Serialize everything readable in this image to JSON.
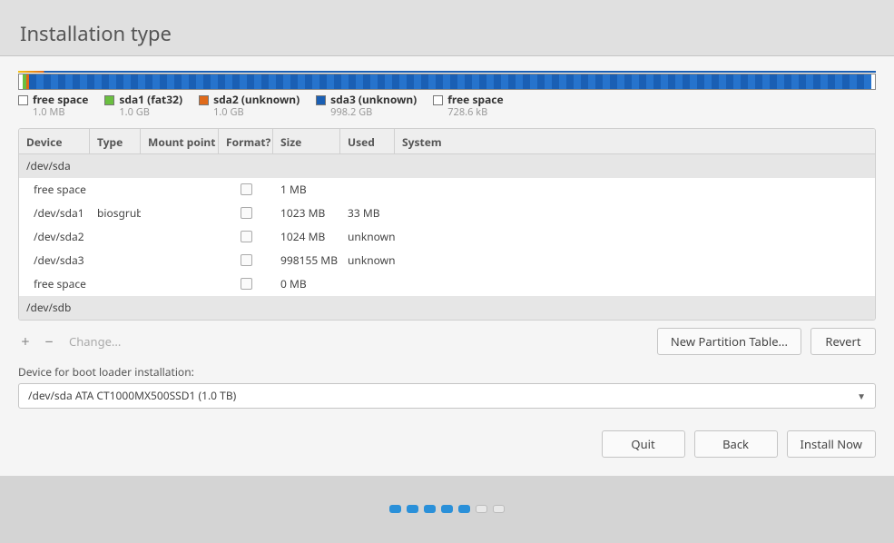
{
  "title": "Installation type",
  "diskbar": [
    {
      "class": "c-free",
      "width": "0.4%"
    },
    {
      "class": "c-green",
      "width": "0.4%"
    },
    {
      "class": "c-orange",
      "width": "0.4%"
    },
    {
      "class": "c-blue",
      "width": "98.4%"
    },
    {
      "class": "c-free",
      "width": "0.4%"
    }
  ],
  "legend": [
    {
      "color": "#ffffff",
      "label": "free space",
      "size": "1.0 MB"
    },
    {
      "color": "#6abf40",
      "label": "sda1 (fat32)",
      "size": "1.0 GB"
    },
    {
      "color": "#e06a1a",
      "label": "sda2 (unknown)",
      "size": "1.0 GB"
    },
    {
      "color": "#1a5fb4",
      "label": "sda3 (unknown)",
      "size": "998.2 GB"
    },
    {
      "color": "#ffffff",
      "label": "free space",
      "size": "728.6 kB"
    }
  ],
  "columns": {
    "device": "Device",
    "type": "Type",
    "mount": "Mount point",
    "format": "Format?",
    "size": "Size",
    "used": "Used",
    "system": "System"
  },
  "rows": [
    {
      "kind": "disk",
      "device": "/dev/sda"
    },
    {
      "kind": "part",
      "device": "free space",
      "type": "",
      "mount": "",
      "format": true,
      "size": "1 MB",
      "used": "",
      "system": ""
    },
    {
      "kind": "part",
      "device": "/dev/sda1",
      "type": "biosgrub",
      "mount": "",
      "format": true,
      "size": "1023 MB",
      "used": "33 MB",
      "system": ""
    },
    {
      "kind": "part",
      "device": "/dev/sda2",
      "type": "",
      "mount": "",
      "format": true,
      "size": "1024 MB",
      "used": "unknown",
      "system": ""
    },
    {
      "kind": "part",
      "device": "/dev/sda3",
      "type": "",
      "mount": "",
      "format": true,
      "size": "998155 MB",
      "used": "unknown",
      "system": ""
    },
    {
      "kind": "part",
      "device": "free space",
      "type": "",
      "mount": "",
      "format": true,
      "size": "0 MB",
      "used": "",
      "system": ""
    },
    {
      "kind": "disk",
      "device": "/dev/sdb"
    }
  ],
  "toolbar": {
    "add": "+",
    "remove": "−",
    "change": "Change...",
    "new_table": "New Partition Table...",
    "revert": "Revert"
  },
  "bootloader": {
    "label": "Device for boot loader installation:",
    "value": "/dev/sda   ATA CT1000MX500SSD1 (1.0 TB)"
  },
  "footer": {
    "quit": "Quit",
    "back": "Back",
    "install": "Install Now"
  },
  "progress": {
    "total": 7,
    "active": 5
  }
}
